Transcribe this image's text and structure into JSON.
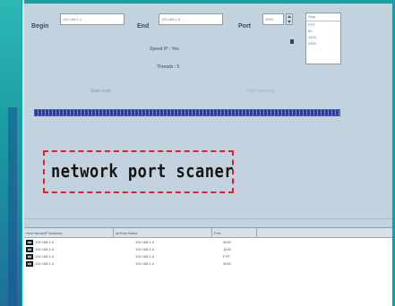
{
  "form": {
    "begin_label": "Begin",
    "begin_value": "192.168.1.1",
    "end_label": "End",
    "end_value": "192.168.1.5",
    "port_label": "Port",
    "port_value": "4000"
  },
  "protocol_list": {
    "header": "Stop",
    "items": [
      "FTP",
      "80",
      "1433",
      "4000"
    ]
  },
  "status": {
    "speed_ip": "Speed IP : Yes",
    "threads": "Threads : 5"
  },
  "links": {
    "start": "Start scan",
    "stop": "Stop scanning"
  },
  "title_text": "network port scaner",
  "results": {
    "columns": [
      "Host Name/IP Address",
      "Ip/Host Name",
      "Port"
    ],
    "rows": [
      [
        "192.168.1.4",
        "192.168.1.4",
        "4000"
      ],
      [
        "192.168.1.5",
        "192.168.1.5",
        "1433"
      ],
      [
        "192.168.1.5",
        "192.168.1.5",
        "FTP"
      ],
      [
        "192.168.1.3",
        "192.168.1.3",
        "4000"
      ]
    ]
  },
  "colors": {
    "background": "#16a3a6",
    "panel": "#c2d2df",
    "progress": "#2a3b9e",
    "annotation_border": "#e0202a"
  }
}
